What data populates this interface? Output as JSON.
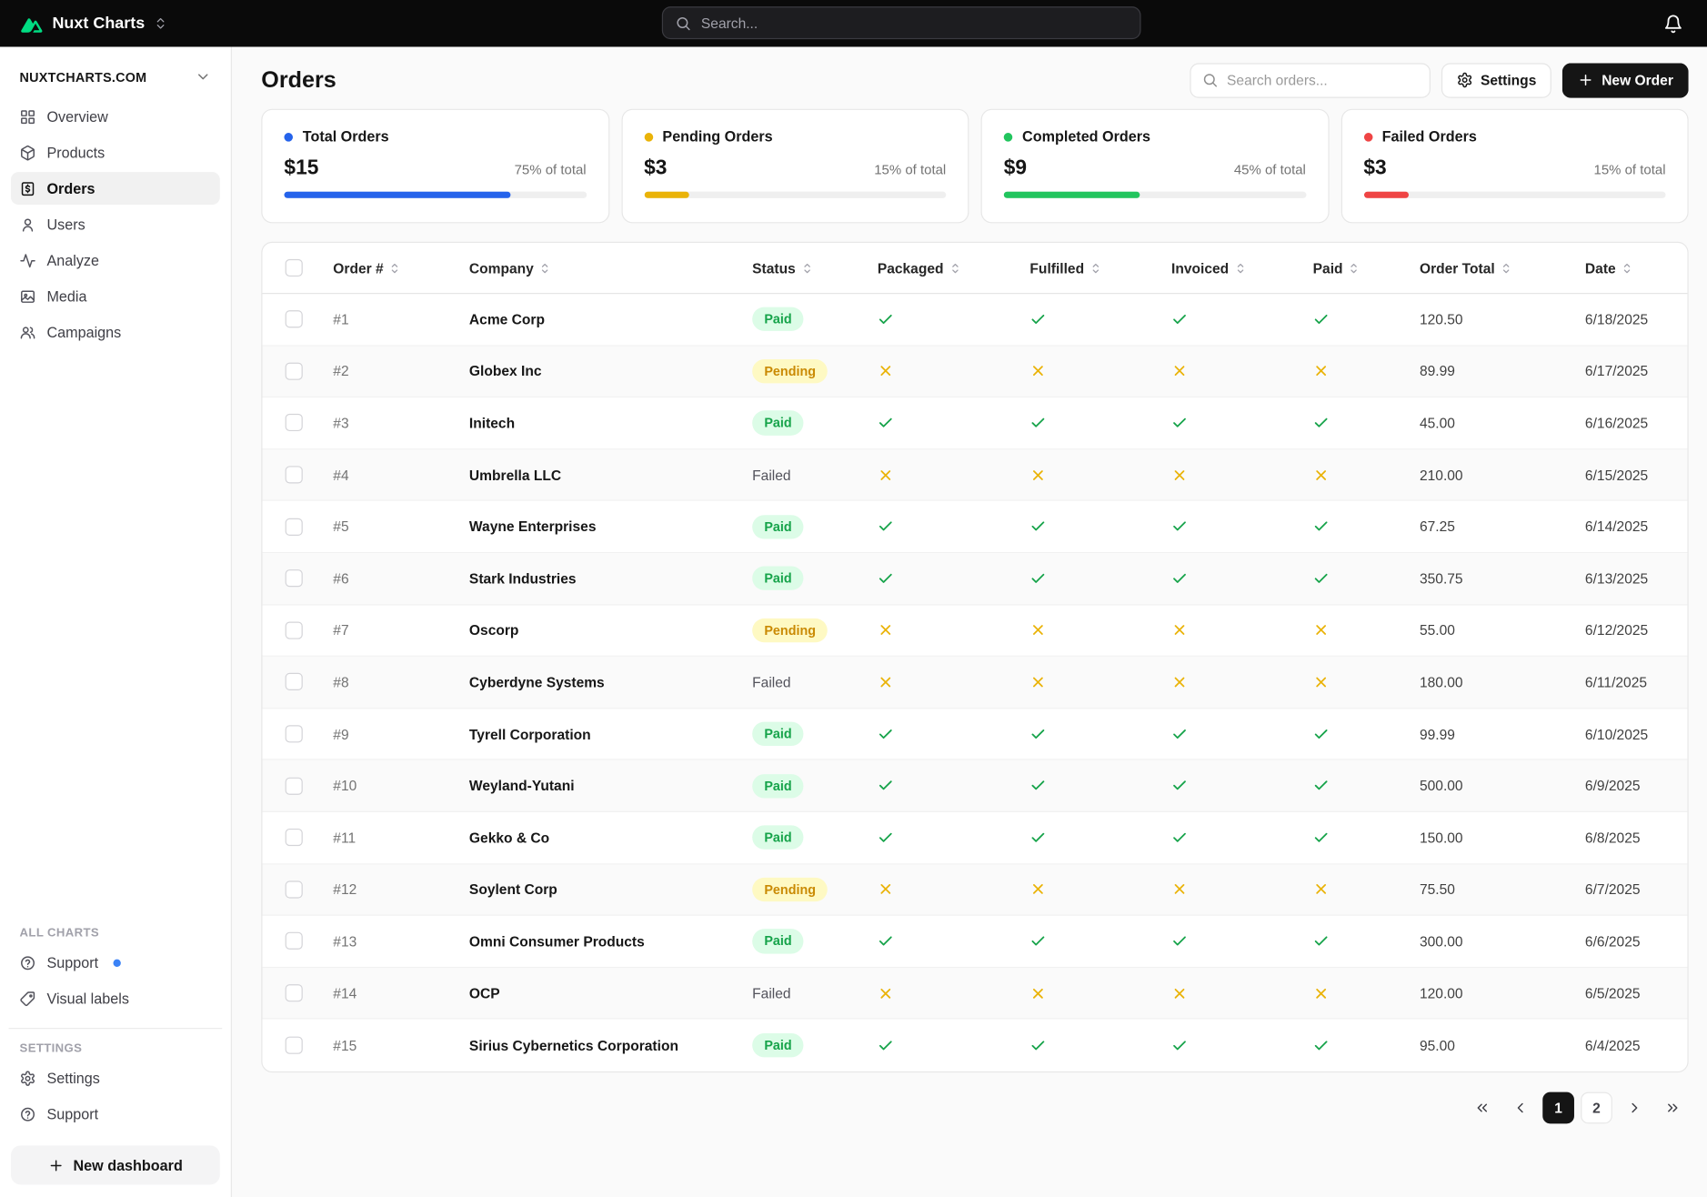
{
  "topbar": {
    "brand": "Nuxt Charts",
    "brand_icon": "nuxt-logo-icon",
    "search_placeholder": "Search...",
    "bell_icon": "bell-icon"
  },
  "sidebar": {
    "workspace": "NUXTCHARTS.COM",
    "nav": [
      {
        "label": "Overview",
        "icon": "grid-icon"
      },
      {
        "label": "Products",
        "icon": "package-icon"
      },
      {
        "label": "Orders",
        "icon": "receipt-dollar-icon",
        "active": true
      },
      {
        "label": "Users",
        "icon": "user-icon"
      },
      {
        "label": "Analyze",
        "icon": "activity-icon"
      },
      {
        "label": "Media",
        "icon": "image-icon"
      },
      {
        "label": "Campaigns",
        "icon": "users-icon"
      }
    ],
    "all_charts_label": "ALL CHARTS",
    "all_charts": [
      {
        "label": "Support",
        "icon": "help-circle-icon",
        "dot": true
      },
      {
        "label": "Visual labels",
        "icon": "tag-icon"
      }
    ],
    "settings_label": "SETTINGS",
    "settings": [
      {
        "label": "Settings",
        "icon": "gear-icon"
      },
      {
        "label": "Support",
        "icon": "help-circle-icon"
      }
    ],
    "new_dashboard": "New dashboard"
  },
  "header": {
    "title": "Orders",
    "search_placeholder": "Search orders...",
    "settings_button": "Settings",
    "new_order_button": "New Order"
  },
  "stats": [
    {
      "label": "Total Orders",
      "value": "$15",
      "percent": 75,
      "percent_label": "75% of total",
      "color": "#2563eb"
    },
    {
      "label": "Pending Orders",
      "value": "$3",
      "percent": 15,
      "percent_label": "15% of total",
      "color": "#eab308"
    },
    {
      "label": "Completed Orders",
      "value": "$9",
      "percent": 45,
      "percent_label": "45% of total",
      "color": "#22c55e"
    },
    {
      "label": "Failed Orders",
      "value": "$3",
      "percent": 15,
      "percent_label": "15% of total",
      "color": "#ef4444"
    }
  ],
  "table": {
    "columns": [
      "Order #",
      "Company",
      "Status",
      "Packaged",
      "Fulfilled",
      "Invoiced",
      "Paid",
      "Order Total",
      "Date"
    ],
    "rows": [
      {
        "order": "#1",
        "company": "Acme Corp",
        "status": "Paid",
        "packaged": true,
        "fulfilled": true,
        "invoiced": true,
        "paid": true,
        "total": "120.50",
        "date": "6/18/2025"
      },
      {
        "order": "#2",
        "company": "Globex Inc",
        "status": "Pending",
        "packaged": false,
        "fulfilled": false,
        "invoiced": false,
        "paid": false,
        "total": "89.99",
        "date": "6/17/2025"
      },
      {
        "order": "#3",
        "company": "Initech",
        "status": "Paid",
        "packaged": true,
        "fulfilled": true,
        "invoiced": true,
        "paid": true,
        "total": "45.00",
        "date": "6/16/2025"
      },
      {
        "order": "#4",
        "company": "Umbrella LLC",
        "status": "Failed",
        "packaged": false,
        "fulfilled": false,
        "invoiced": false,
        "paid": false,
        "total": "210.00",
        "date": "6/15/2025"
      },
      {
        "order": "#5",
        "company": "Wayne Enterprises",
        "status": "Paid",
        "packaged": true,
        "fulfilled": true,
        "invoiced": true,
        "paid": true,
        "total": "67.25",
        "date": "6/14/2025"
      },
      {
        "order": "#6",
        "company": "Stark Industries",
        "status": "Paid",
        "packaged": true,
        "fulfilled": true,
        "invoiced": true,
        "paid": true,
        "total": "350.75",
        "date": "6/13/2025"
      },
      {
        "order": "#7",
        "company": "Oscorp",
        "status": "Pending",
        "packaged": false,
        "fulfilled": false,
        "invoiced": false,
        "paid": false,
        "total": "55.00",
        "date": "6/12/2025"
      },
      {
        "order": "#8",
        "company": "Cyberdyne Systems",
        "status": "Failed",
        "packaged": false,
        "fulfilled": false,
        "invoiced": false,
        "paid": false,
        "total": "180.00",
        "date": "6/11/2025"
      },
      {
        "order": "#9",
        "company": "Tyrell Corporation",
        "status": "Paid",
        "packaged": true,
        "fulfilled": true,
        "invoiced": true,
        "paid": true,
        "total": "99.99",
        "date": "6/10/2025"
      },
      {
        "order": "#10",
        "company": "Weyland-Yutani",
        "status": "Paid",
        "packaged": true,
        "fulfilled": true,
        "invoiced": true,
        "paid": true,
        "total": "500.00",
        "date": "6/9/2025"
      },
      {
        "order": "#11",
        "company": "Gekko & Co",
        "status": "Paid",
        "packaged": true,
        "fulfilled": true,
        "invoiced": true,
        "paid": true,
        "total": "150.00",
        "date": "6/8/2025"
      },
      {
        "order": "#12",
        "company": "Soylent Corp",
        "status": "Pending",
        "packaged": false,
        "fulfilled": false,
        "invoiced": false,
        "paid": false,
        "total": "75.50",
        "date": "6/7/2025"
      },
      {
        "order": "#13",
        "company": "Omni Consumer Products",
        "status": "Paid",
        "packaged": true,
        "fulfilled": true,
        "invoiced": true,
        "paid": true,
        "total": "300.00",
        "date": "6/6/2025"
      },
      {
        "order": "#14",
        "company": "OCP",
        "status": "Failed",
        "packaged": false,
        "fulfilled": false,
        "invoiced": false,
        "paid": false,
        "total": "120.00",
        "date": "6/5/2025"
      },
      {
        "order": "#15",
        "company": "Sirius Cybernetics Corporation",
        "status": "Paid",
        "packaged": true,
        "fulfilled": true,
        "invoiced": true,
        "paid": true,
        "total": "95.00",
        "date": "6/4/2025"
      }
    ]
  },
  "pagination": {
    "first_icon": "chevrons-left-icon",
    "prev_icon": "chevron-left-icon",
    "next_icon": "chevron-right-icon",
    "last_icon": "chevrons-right-icon",
    "pages": [
      "1",
      "2"
    ],
    "active_page": "1"
  },
  "colors": {
    "accent_green": "#00DC82",
    "check": "#16a34a",
    "cross": "#eab308",
    "badge_paid_bg": "#dcfce7",
    "badge_pending_bg": "#fef9c3"
  }
}
